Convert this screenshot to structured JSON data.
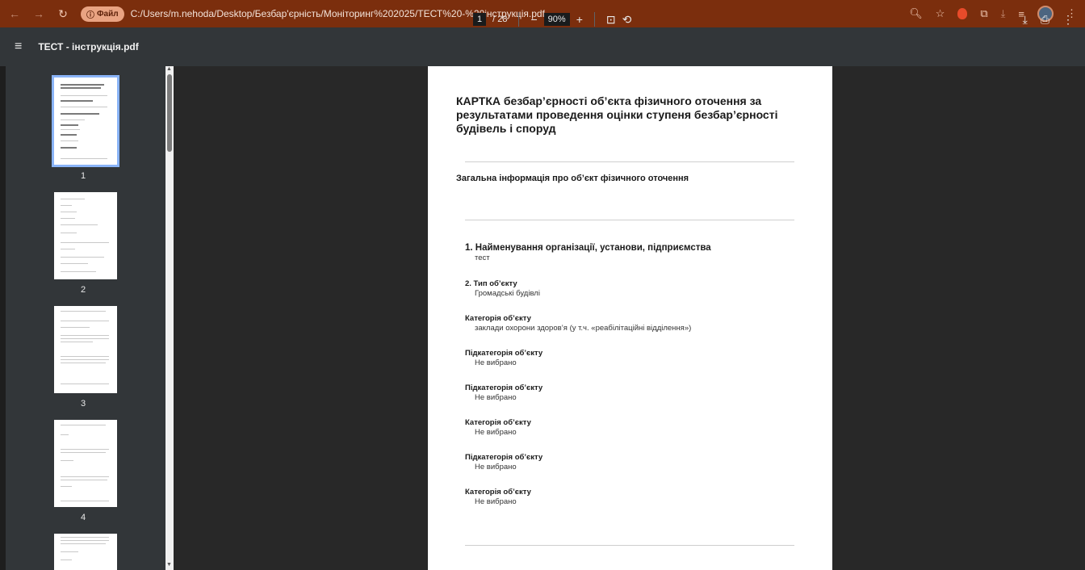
{
  "browser": {
    "file_chip": "Файл",
    "url": "C:/Users/m.nehoda/Desktop/Безбар'єрність/Моніторинг%202025/ТЕСТ%20-%20інструкція.pdf"
  },
  "toolbar": {
    "title": "ТЕСТ - інструкція.pdf",
    "page_current": "1",
    "page_total": "/ 28",
    "zoom": "90%"
  },
  "sidebar": {
    "pages": [
      "1",
      "2",
      "3",
      "4"
    ]
  },
  "document": {
    "title": "КАРТКА безбар’єрності об’єкта фізичного оточення за результатами проведення оцінки ступеня безбар’єрності будівель і споруд",
    "section": "Загальна інформація про об’єкт фізичного оточення",
    "fields": [
      {
        "label": "1. Найменування організації, установи, підприємства",
        "value": "тест"
      },
      {
        "label": "2. Тип об’єкту",
        "value": "Громадські будівлі"
      },
      {
        "label": "Категорія об’єкту",
        "value": "заклади охорони здоров’я (у т.ч. «реабілітаційні відділення»)"
      },
      {
        "label": "Підкатегорія об’єкту",
        "value": "Не вибрано"
      },
      {
        "label": "Підкатегорія об’єкту",
        "value": "Не вибрано"
      },
      {
        "label": "Категорія об’єкту",
        "value": "Не вибрано"
      },
      {
        "label": "Підкатегорія об’єкту",
        "value": "Не вибрано"
      },
      {
        "label": "Категорія об’єкту",
        "value": "Не вибрано"
      }
    ]
  }
}
